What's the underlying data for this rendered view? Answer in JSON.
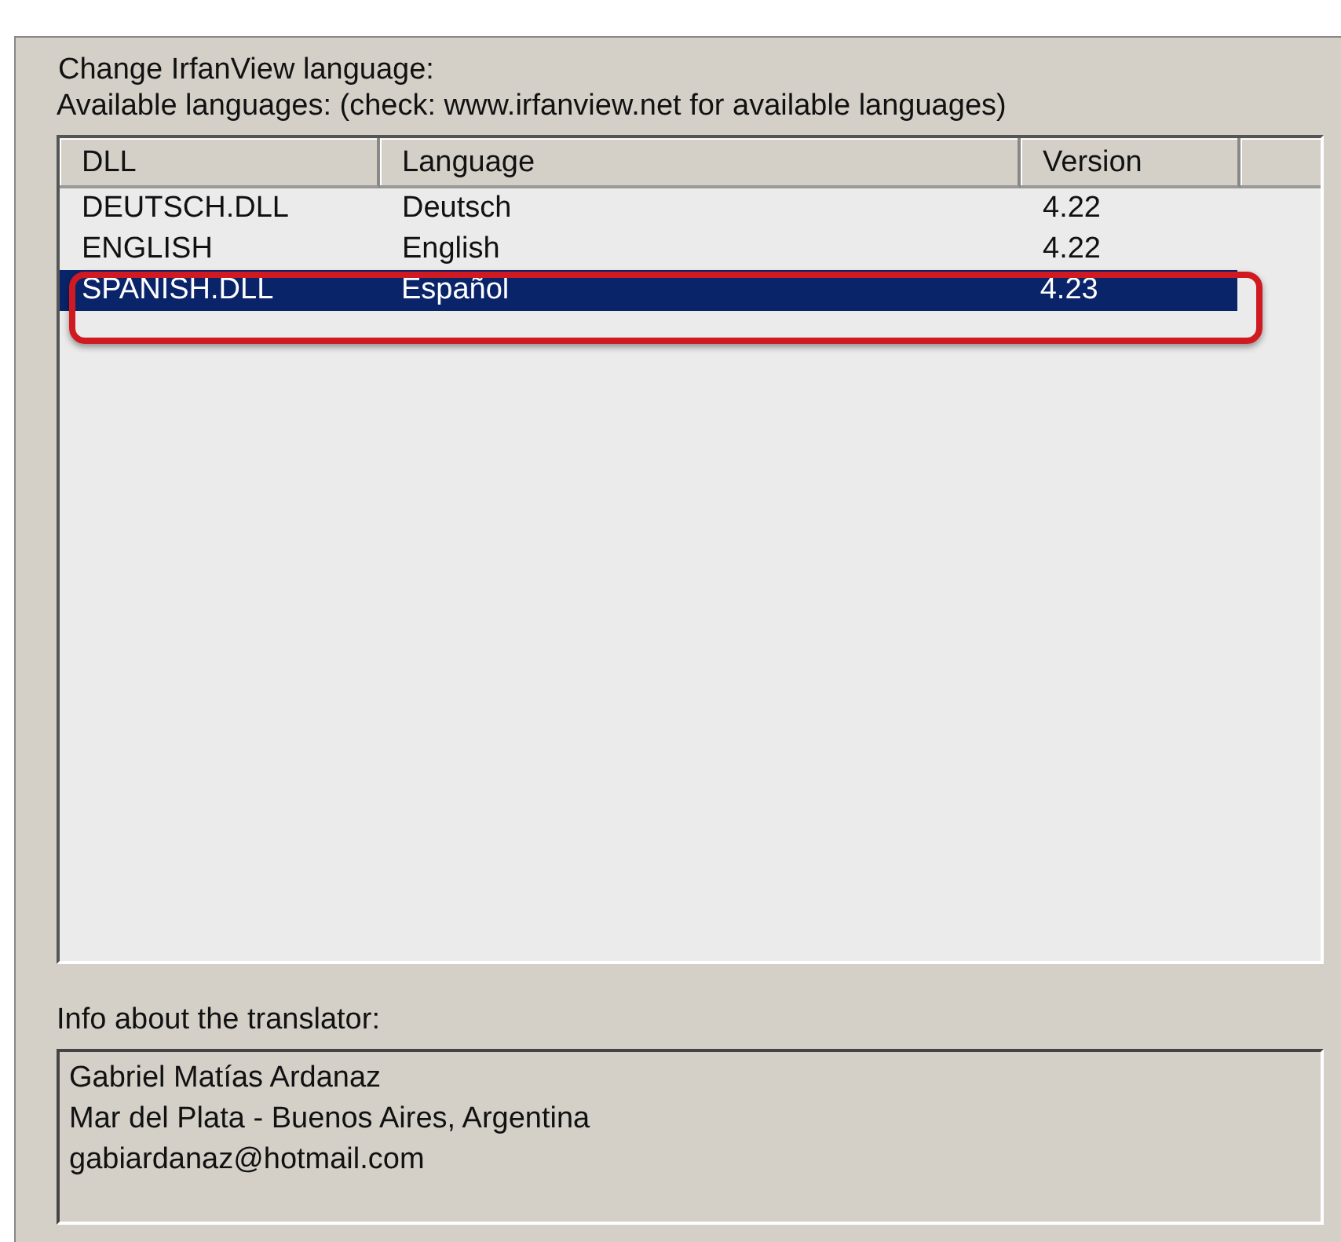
{
  "group": {
    "title": "Change IrfanView language:"
  },
  "languages_label": "Available languages: (check: www.irfanview.net for available languages)",
  "table": {
    "columns": [
      "DLL",
      "Language",
      "Version"
    ],
    "rows": [
      {
        "cells": [
          "DEUTSCH.DLL",
          "Deutsch",
          "4.22"
        ],
        "selected": false
      },
      {
        "cells": [
          "ENGLISH",
          "English",
          "4.22"
        ],
        "selected": false
      },
      {
        "cells": [
          "SPANISH.DLL",
          "Español",
          "4.23"
        ],
        "selected": true
      }
    ]
  },
  "info_label": "Info about the translator:",
  "info_lines": [
    "Gabriel Matías Ardanaz",
    "Mar del Plata - Buenos Aires, Argentina",
    "gabiardanaz@hotmail.com"
  ]
}
